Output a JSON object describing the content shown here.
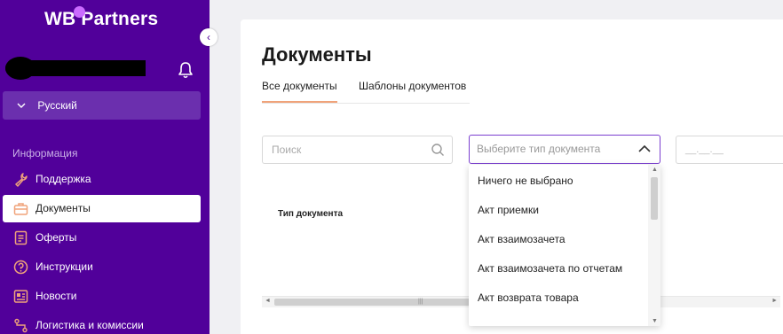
{
  "sidebar": {
    "logo_left": "WB",
    "logo_right": "Partners",
    "collapse_icon": "‹",
    "language": "Русский",
    "section_title": "Информация",
    "items": [
      {
        "label": "Поддержка",
        "icon": "wrench-icon",
        "active": false
      },
      {
        "label": "Документы",
        "icon": "briefcase-icon",
        "active": true
      },
      {
        "label": "Оферты",
        "icon": "document-icon",
        "active": false
      },
      {
        "label": "Инструкции",
        "icon": "question-icon",
        "active": false
      },
      {
        "label": "Новости",
        "icon": "news-icon",
        "active": false
      },
      {
        "label": "Логистика и комиссии",
        "icon": "route-icon",
        "active": false
      }
    ],
    "colors": {
      "background": "#51009a",
      "accent": "#f0a37a"
    }
  },
  "main": {
    "title": "Документы",
    "tabs": [
      {
        "label": "Все документы",
        "active": true
      },
      {
        "label": "Шаблоны документов",
        "active": false
      }
    ],
    "search": {
      "placeholder": "Поиск"
    },
    "doc_type_select": {
      "placeholder": "Выберите тип документа",
      "expanded": true
    },
    "date_field": {
      "placeholder": "__.__.__"
    },
    "table": {
      "columns": [
        "Тип документа"
      ]
    }
  },
  "dropdown": {
    "options": [
      "Ничего не выбрано",
      "Акт приемки",
      "Акт взаимозачета",
      "Акт взаимозачета по отчетам",
      "Акт возврата товара"
    ]
  }
}
